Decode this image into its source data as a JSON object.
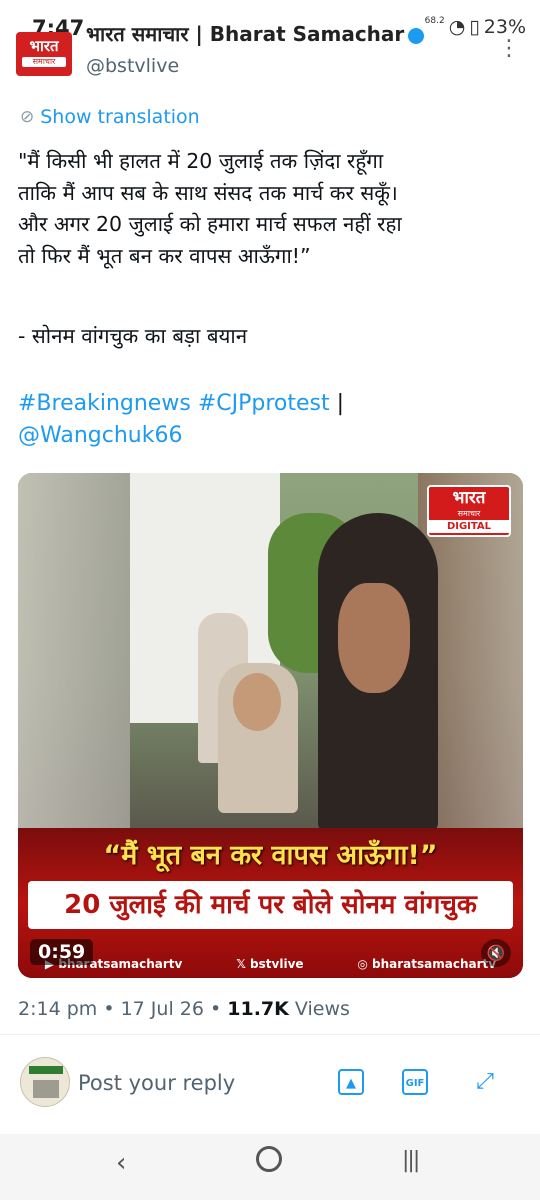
{
  "status_bar": {
    "time": "7:47",
    "signal": "68.2",
    "battery": "23%"
  },
  "account": {
    "avatar_line1": "भारत",
    "avatar_line2": "समाचार",
    "name": "भारत समाचार | Bharat Samachar",
    "handle": "@bstvlive"
  },
  "tweet": {
    "show_translation": "Show translation",
    "text": "\"मैं किसी भी हालत में 20 जुलाई तक ज़िंदा रहूँगा\nताकि मैं आप सब के साथ संसद तक मार्च कर सकूँ।\nऔर अगर 20 जुलाई को हमारा मार्च सफल नहीं रहा\nतो फिर मैं भूत बन कर वापस आऊँगा!”",
    "quote_line": "- सोनम वांगचुक का बड़ा बयान",
    "hashtag1": "#Breakingnews",
    "hashtag2": "#CJPprotest",
    "separator": "|",
    "mention": "@Wangchuk66"
  },
  "media": {
    "logo_line1": "भारत",
    "logo_line2": "समाचार",
    "logo_line3": "DIGITAL",
    "caption1": "“मैं भूत बन कर वापस आऊँगा!”",
    "caption2": "20 जुलाई की मार्च पर बोले सोनम वांगचुक",
    "footer_youtube": "bharatsamachartv",
    "footer_x": "bstvlive",
    "footer_instagram": "bharatsamachartv",
    "duration": "0:59"
  },
  "meta": {
    "time": "2:14 pm",
    "dot1": "•",
    "date": "17 Jul 26",
    "dot2": "•",
    "views_count": "11.7K",
    "views_label": "Views"
  },
  "reply": {
    "placeholder": "Post your reply",
    "gif_label": "GIF"
  }
}
